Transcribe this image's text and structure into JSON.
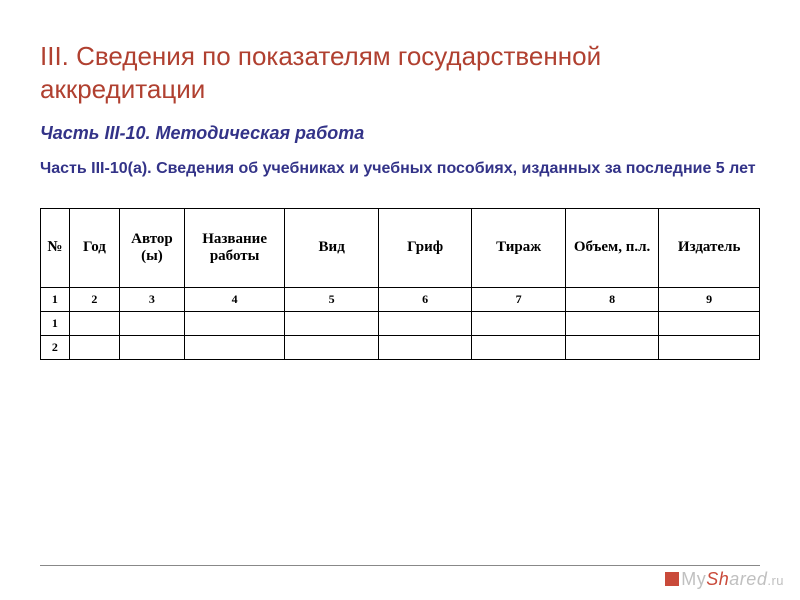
{
  "title": "III. Сведения по показателям государственной аккредитации",
  "subtitle1": "Часть III-10. Методическая работа",
  "subtitle2": "Часть III-10(а). Сведения об учебниках и учебных пособиях, изданных за последние 5 лет",
  "table": {
    "headers": [
      "№",
      "Год",
      "Автор (ы)",
      "Название работы",
      "Вид",
      "Гриф",
      "Тираж",
      "Объем, п.л.",
      "Издатель"
    ],
    "column_numbers": [
      "1",
      "2",
      "3",
      "4",
      "5",
      "6",
      "7",
      "8",
      "9"
    ],
    "rows": [
      [
        "1",
        "",
        "",
        "",
        "",
        "",
        "",
        "",
        ""
      ],
      [
        "2",
        "",
        "",
        "",
        "",
        "",
        "",
        "",
        ""
      ]
    ]
  },
  "watermark": {
    "my": "My",
    "sh": "Sh",
    "ared": "ared",
    "ru": ".ru"
  }
}
